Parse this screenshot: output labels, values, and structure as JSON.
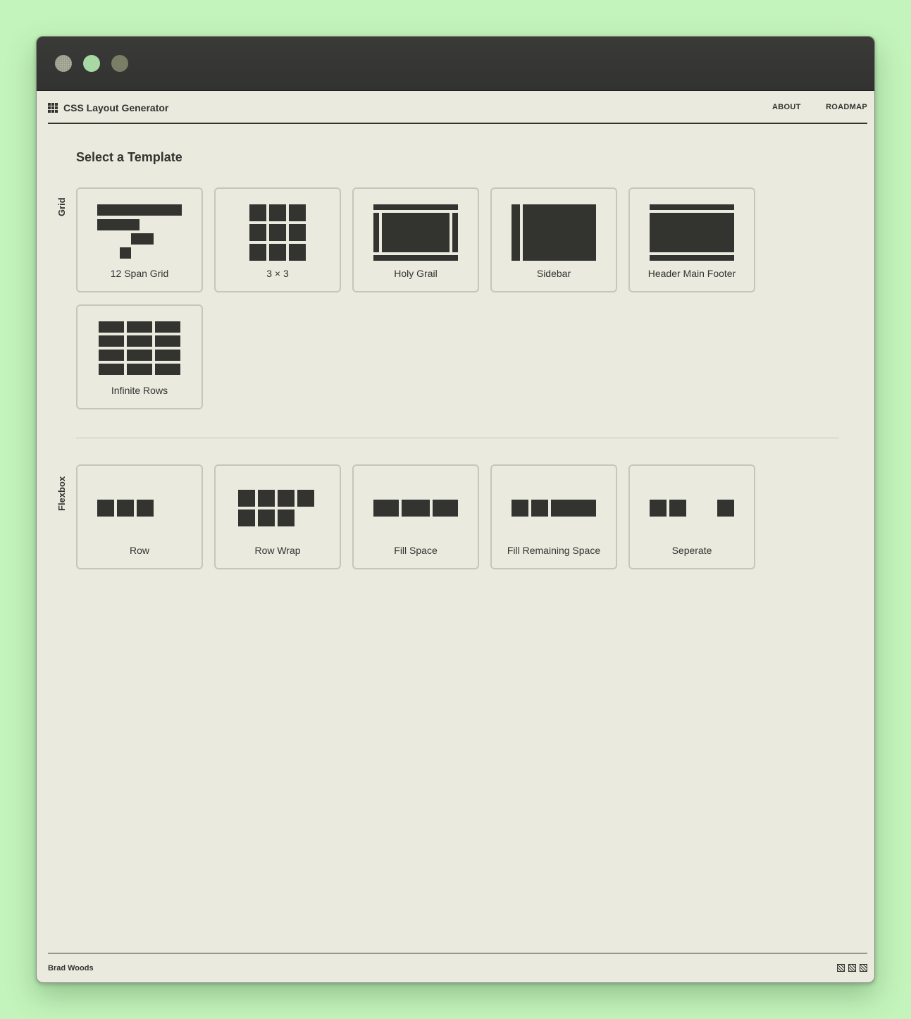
{
  "app": {
    "title": "CSS Layout Generator"
  },
  "nav": {
    "about": "ABOUT",
    "roadmap": "ROADMAP"
  },
  "page": {
    "heading": "Select a Template"
  },
  "sections": {
    "grid": {
      "label": "Grid",
      "templates": [
        {
          "label": "12 Span Grid"
        },
        {
          "label": "3 × 3"
        },
        {
          "label": "Holy Grail"
        },
        {
          "label": "Sidebar"
        },
        {
          "label": "Header Main Footer"
        },
        {
          "label": "Infinite Rows"
        }
      ]
    },
    "flexbox": {
      "label": "Flexbox",
      "templates": [
        {
          "label": "Row"
        },
        {
          "label": "Row Wrap"
        },
        {
          "label": "Fill Space"
        },
        {
          "label": "Fill Remaining Space"
        },
        {
          "label": "Seperate"
        }
      ]
    }
  },
  "footer": {
    "author": "Brad Woods"
  },
  "colors": {
    "background": "#c3f4bb",
    "window": "#eaeadf",
    "ink": "#333330",
    "titlebar": "#353533"
  }
}
